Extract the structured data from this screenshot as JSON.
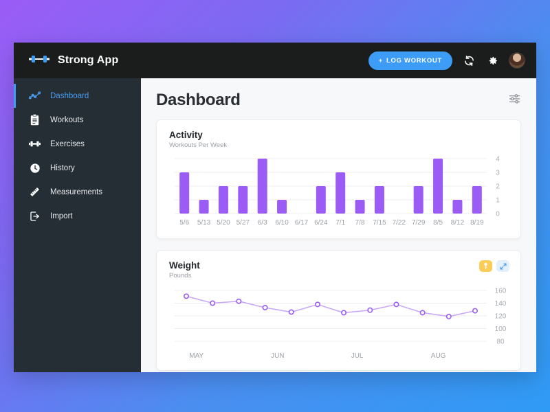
{
  "app": {
    "brand_title": "Strong App",
    "logo_icon": "dumbbell-icon"
  },
  "topbar": {
    "log_workout_label": "LOG WORKOUT",
    "plus_glyph": "+",
    "sync_icon": "sync-icon",
    "settings_icon": "gear-icon",
    "avatar_icon": "user-avatar"
  },
  "sidebar": {
    "items": [
      {
        "label": "Dashboard",
        "icon": "line-chart-icon",
        "active": true
      },
      {
        "label": "Workouts",
        "icon": "clipboard-icon",
        "active": false
      },
      {
        "label": "Exercises",
        "icon": "dumbbell-icon",
        "active": false
      },
      {
        "label": "History",
        "icon": "clock-icon",
        "active": false
      },
      {
        "label": "Measurements",
        "icon": "ruler-icon",
        "active": false
      },
      {
        "label": "Import",
        "icon": "import-icon",
        "active": false
      }
    ]
  },
  "page": {
    "title": "Dashboard",
    "tune_icon": "sliders-icon"
  },
  "cards": {
    "activity": {
      "title": "Activity",
      "subtitle": "Workouts Per Week"
    },
    "weight": {
      "title": "Weight",
      "subtitle": "Pounds",
      "action_key_icon": "key-badge-icon",
      "action_expand_icon": "expand-arrows-icon"
    }
  },
  "colors": {
    "accent_blue": "#3d9cf5",
    "purple": "#9b5cf6",
    "line_purple": "#c9a8f7",
    "sidebar_bg": "#252e35",
    "topbar_bg": "#1b1c1c",
    "page_bg": "#f7f8f9",
    "chip_yellow": "#fbcd58",
    "chip_blue": "#e2f0fc"
  },
  "chart_data": [
    {
      "type": "bar",
      "title": "Activity",
      "subtitle": "Workouts Per Week",
      "xlabel": "",
      "ylabel": "",
      "ylim": [
        0,
        4
      ],
      "yticks": [
        0,
        1,
        2,
        3,
        4
      ],
      "grid": true,
      "legend": "none",
      "categories": [
        "5/6",
        "5/13",
        "5/20",
        "5/27",
        "6/3",
        "6/10",
        "6/17",
        "6/24",
        "7/1",
        "7/8",
        "7/15",
        "7/22",
        "7/29",
        "8/5",
        "8/12",
        "8/19"
      ],
      "values": [
        3,
        1,
        2,
        2,
        4,
        1,
        0,
        2,
        3,
        1,
        2,
        0,
        2,
        4,
        1,
        2
      ]
    },
    {
      "type": "line",
      "title": "Weight",
      "subtitle": "Pounds",
      "xlabel": "",
      "ylabel": "Pounds",
      "ylim": [
        80,
        160
      ],
      "yticks": [
        80,
        100,
        120,
        140,
        160
      ],
      "grid": true,
      "legend": "none",
      "xtick_labels": [
        "MAY",
        "JUN",
        "JUL",
        "AUG"
      ],
      "values": [
        151,
        140,
        143,
        133,
        126,
        138,
        125,
        129,
        138,
        125,
        119,
        128
      ],
      "markers": "open-circle"
    }
  ]
}
